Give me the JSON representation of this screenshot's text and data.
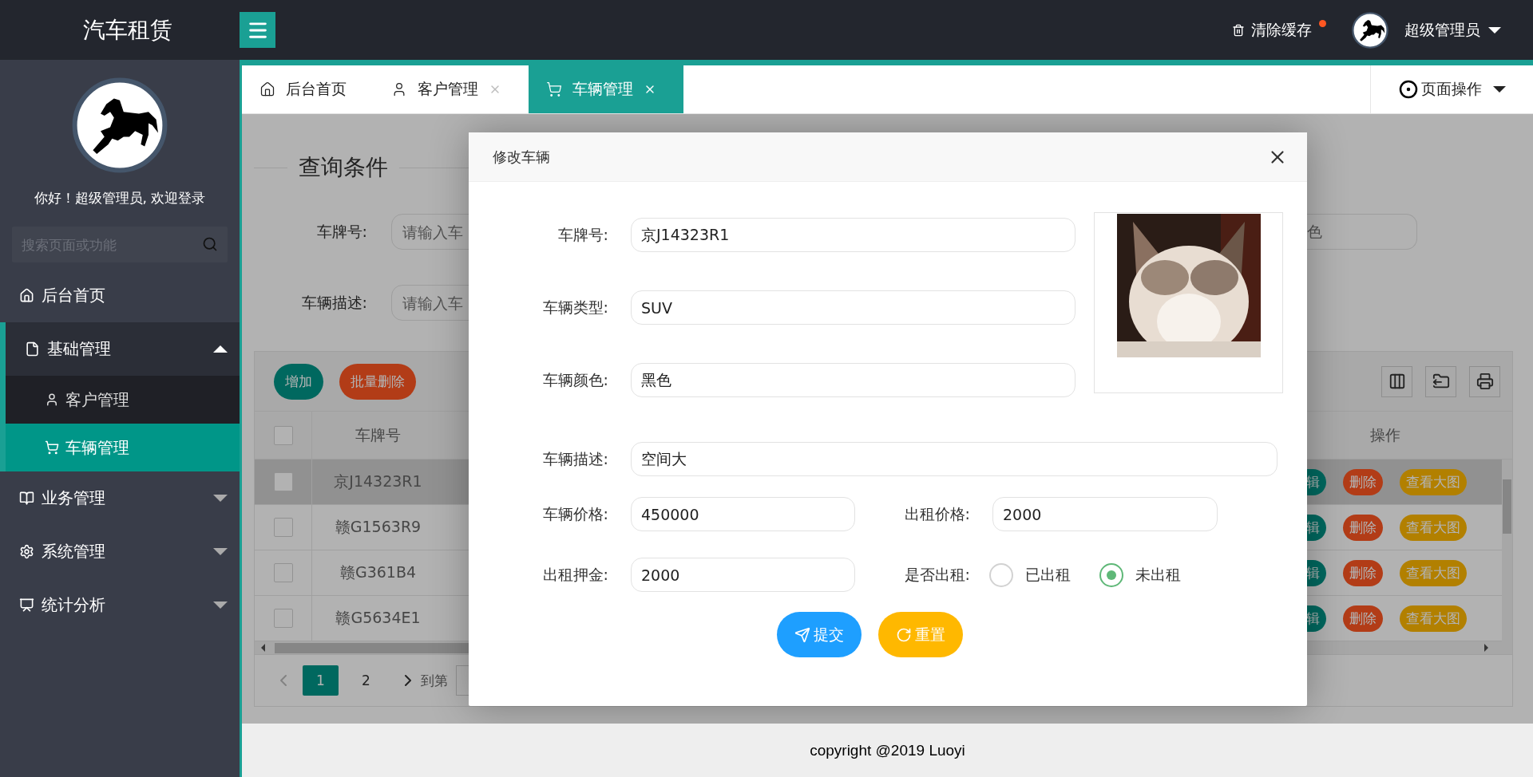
{
  "header": {
    "logo": "汽车租赁",
    "clear_cache": "清除缓存",
    "cache_notice": true,
    "user": "超级管理员"
  },
  "sidebar": {
    "greeting": "你好！超级管理员, 欢迎登录",
    "search": {
      "placeholder": "搜索页面或功能"
    },
    "items": [
      {
        "kind": "link",
        "label": "后台首页",
        "selected": false
      },
      {
        "kind": "group",
        "label": "基础管理",
        "expanded": true,
        "children": [
          {
            "label": "客户管理",
            "selected": false
          },
          {
            "label": "车辆管理",
            "selected": true
          }
        ]
      },
      {
        "kind": "group",
        "label": "业务管理",
        "expanded": false
      },
      {
        "kind": "group",
        "label": "系统管理",
        "expanded": false
      },
      {
        "kind": "group",
        "label": "统计分析",
        "expanded": false
      }
    ]
  },
  "tabs": [
    {
      "label": "后台首页",
      "selected": false,
      "closable": false
    },
    {
      "label": "客户管理",
      "selected": false,
      "closable": true
    },
    {
      "label": "车辆管理",
      "selected": true,
      "closable": true
    }
  ],
  "page_actions": "页面操作",
  "search_form": {
    "legend": "查询条件",
    "fields": [
      {
        "label": "车牌号:",
        "placeholder": "请输入车"
      },
      {
        "label": "车辆描述:",
        "placeholder": "请输入车"
      }
    ],
    "partial_field": {
      "placeholder": "色"
    }
  },
  "table": {
    "buttons": [
      {
        "label": "增加",
        "kind": "add"
      },
      {
        "label": "批量删除",
        "kind": "delete"
      }
    ],
    "header_checked": false,
    "columns": [
      "车牌号",
      "操作"
    ],
    "rows": [
      {
        "checked": false,
        "highlighted": true,
        "plate": "京J14323R1",
        "actions": [
          {
            "label": "辑",
            "kind": "edit"
          },
          {
            "label": "删除",
            "kind": "delete"
          },
          {
            "label": "查看大图",
            "kind": "view"
          }
        ]
      },
      {
        "checked": false,
        "highlighted": false,
        "plate": "赣G1563R9",
        "actions": [
          {
            "label": "辑",
            "kind": "edit"
          },
          {
            "label": "删除",
            "kind": "delete"
          },
          {
            "label": "查看大图",
            "kind": "view"
          }
        ]
      },
      {
        "checked": false,
        "highlighted": false,
        "plate": "赣G361B4",
        "actions": [
          {
            "label": "辑",
            "kind": "edit"
          },
          {
            "label": "删除",
            "kind": "delete"
          },
          {
            "label": "查看大图",
            "kind": "view"
          }
        ]
      },
      {
        "checked": false,
        "highlighted": false,
        "plate": "赣G5634E1",
        "actions": [
          {
            "label": "辑",
            "kind": "edit"
          },
          {
            "label": "删除",
            "kind": "delete"
          },
          {
            "label": "查看大图",
            "kind": "view"
          }
        ]
      }
    ]
  },
  "pagination": {
    "pages": [
      {
        "label": "1",
        "selected": true
      },
      {
        "label": "2",
        "selected": false
      }
    ],
    "goto": "到第"
  },
  "dialog": {
    "title": "修改车辆",
    "fields": [
      {
        "label": "车牌号:",
        "value": "京J14323R1"
      },
      {
        "label": "车辆类型:",
        "value": "SUV"
      },
      {
        "label": "车辆颜色:",
        "value": "黑色"
      },
      {
        "label": "车辆描述:",
        "value": "空间大"
      },
      {
        "label": "车辆价格:",
        "value": "450000"
      },
      {
        "label": "出租价格:",
        "value": "2000"
      },
      {
        "label": "出租押金:",
        "value": "2000"
      }
    ],
    "rented": {
      "label": "是否出租:",
      "options": [
        {
          "label": "已出租",
          "selected": false
        },
        {
          "label": "未出租",
          "selected": true
        }
      ]
    },
    "buttons": [
      {
        "label": "提交",
        "kind": "submit"
      },
      {
        "label": "重置",
        "kind": "reset"
      }
    ]
  },
  "footer": "copyright @2019 Luoyi"
}
